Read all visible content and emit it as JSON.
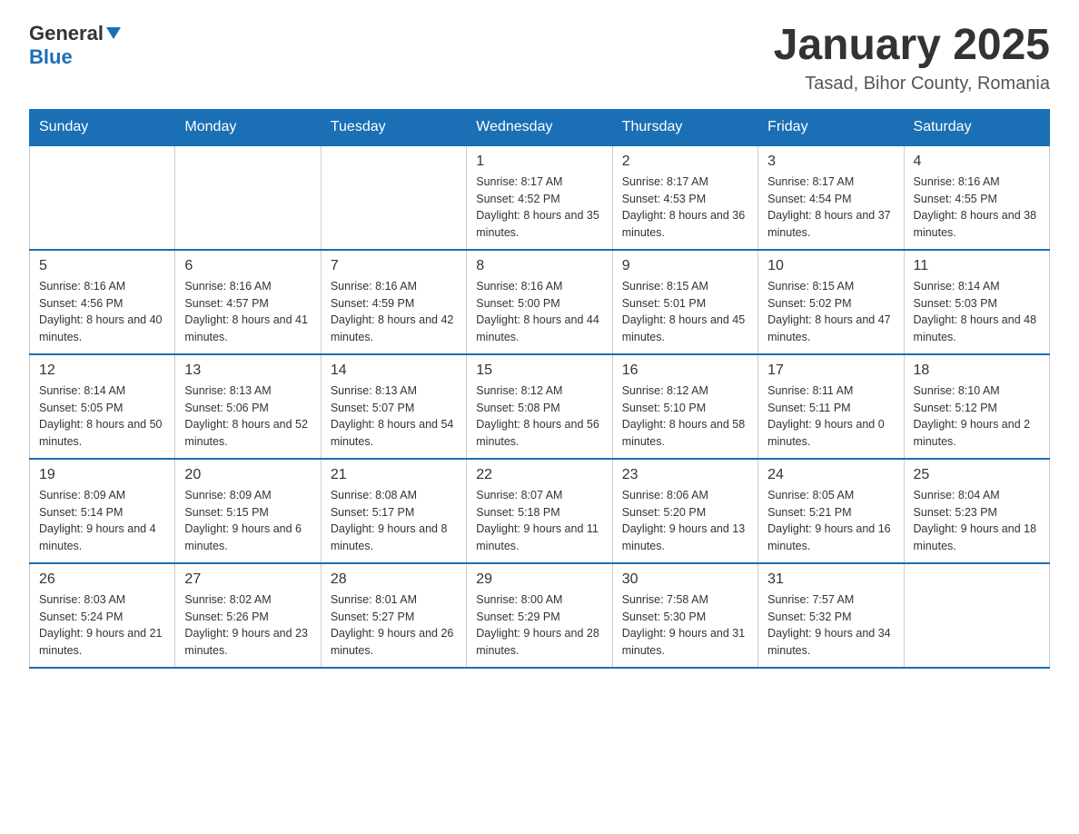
{
  "header": {
    "logo_general": "General",
    "logo_blue": "Blue",
    "title": "January 2025",
    "subtitle": "Tasad, Bihor County, Romania"
  },
  "days_of_week": [
    "Sunday",
    "Monday",
    "Tuesday",
    "Wednesday",
    "Thursday",
    "Friday",
    "Saturday"
  ],
  "weeks": [
    [
      {
        "day": "",
        "info": ""
      },
      {
        "day": "",
        "info": ""
      },
      {
        "day": "",
        "info": ""
      },
      {
        "day": "1",
        "info": "Sunrise: 8:17 AM\nSunset: 4:52 PM\nDaylight: 8 hours\nand 35 minutes."
      },
      {
        "day": "2",
        "info": "Sunrise: 8:17 AM\nSunset: 4:53 PM\nDaylight: 8 hours\nand 36 minutes."
      },
      {
        "day": "3",
        "info": "Sunrise: 8:17 AM\nSunset: 4:54 PM\nDaylight: 8 hours\nand 37 minutes."
      },
      {
        "day": "4",
        "info": "Sunrise: 8:16 AM\nSunset: 4:55 PM\nDaylight: 8 hours\nand 38 minutes."
      }
    ],
    [
      {
        "day": "5",
        "info": "Sunrise: 8:16 AM\nSunset: 4:56 PM\nDaylight: 8 hours\nand 40 minutes."
      },
      {
        "day": "6",
        "info": "Sunrise: 8:16 AM\nSunset: 4:57 PM\nDaylight: 8 hours\nand 41 minutes."
      },
      {
        "day": "7",
        "info": "Sunrise: 8:16 AM\nSunset: 4:59 PM\nDaylight: 8 hours\nand 42 minutes."
      },
      {
        "day": "8",
        "info": "Sunrise: 8:16 AM\nSunset: 5:00 PM\nDaylight: 8 hours\nand 44 minutes."
      },
      {
        "day": "9",
        "info": "Sunrise: 8:15 AM\nSunset: 5:01 PM\nDaylight: 8 hours\nand 45 minutes."
      },
      {
        "day": "10",
        "info": "Sunrise: 8:15 AM\nSunset: 5:02 PM\nDaylight: 8 hours\nand 47 minutes."
      },
      {
        "day": "11",
        "info": "Sunrise: 8:14 AM\nSunset: 5:03 PM\nDaylight: 8 hours\nand 48 minutes."
      }
    ],
    [
      {
        "day": "12",
        "info": "Sunrise: 8:14 AM\nSunset: 5:05 PM\nDaylight: 8 hours\nand 50 minutes."
      },
      {
        "day": "13",
        "info": "Sunrise: 8:13 AM\nSunset: 5:06 PM\nDaylight: 8 hours\nand 52 minutes."
      },
      {
        "day": "14",
        "info": "Sunrise: 8:13 AM\nSunset: 5:07 PM\nDaylight: 8 hours\nand 54 minutes."
      },
      {
        "day": "15",
        "info": "Sunrise: 8:12 AM\nSunset: 5:08 PM\nDaylight: 8 hours\nand 56 minutes."
      },
      {
        "day": "16",
        "info": "Sunrise: 8:12 AM\nSunset: 5:10 PM\nDaylight: 8 hours\nand 58 minutes."
      },
      {
        "day": "17",
        "info": "Sunrise: 8:11 AM\nSunset: 5:11 PM\nDaylight: 9 hours\nand 0 minutes."
      },
      {
        "day": "18",
        "info": "Sunrise: 8:10 AM\nSunset: 5:12 PM\nDaylight: 9 hours\nand 2 minutes."
      }
    ],
    [
      {
        "day": "19",
        "info": "Sunrise: 8:09 AM\nSunset: 5:14 PM\nDaylight: 9 hours\nand 4 minutes."
      },
      {
        "day": "20",
        "info": "Sunrise: 8:09 AM\nSunset: 5:15 PM\nDaylight: 9 hours\nand 6 minutes."
      },
      {
        "day": "21",
        "info": "Sunrise: 8:08 AM\nSunset: 5:17 PM\nDaylight: 9 hours\nand 8 minutes."
      },
      {
        "day": "22",
        "info": "Sunrise: 8:07 AM\nSunset: 5:18 PM\nDaylight: 9 hours\nand 11 minutes."
      },
      {
        "day": "23",
        "info": "Sunrise: 8:06 AM\nSunset: 5:20 PM\nDaylight: 9 hours\nand 13 minutes."
      },
      {
        "day": "24",
        "info": "Sunrise: 8:05 AM\nSunset: 5:21 PM\nDaylight: 9 hours\nand 16 minutes."
      },
      {
        "day": "25",
        "info": "Sunrise: 8:04 AM\nSunset: 5:23 PM\nDaylight: 9 hours\nand 18 minutes."
      }
    ],
    [
      {
        "day": "26",
        "info": "Sunrise: 8:03 AM\nSunset: 5:24 PM\nDaylight: 9 hours\nand 21 minutes."
      },
      {
        "day": "27",
        "info": "Sunrise: 8:02 AM\nSunset: 5:26 PM\nDaylight: 9 hours\nand 23 minutes."
      },
      {
        "day": "28",
        "info": "Sunrise: 8:01 AM\nSunset: 5:27 PM\nDaylight: 9 hours\nand 26 minutes."
      },
      {
        "day": "29",
        "info": "Sunrise: 8:00 AM\nSunset: 5:29 PM\nDaylight: 9 hours\nand 28 minutes."
      },
      {
        "day": "30",
        "info": "Sunrise: 7:58 AM\nSunset: 5:30 PM\nDaylight: 9 hours\nand 31 minutes."
      },
      {
        "day": "31",
        "info": "Sunrise: 7:57 AM\nSunset: 5:32 PM\nDaylight: 9 hours\nand 34 minutes."
      },
      {
        "day": "",
        "info": ""
      }
    ]
  ]
}
